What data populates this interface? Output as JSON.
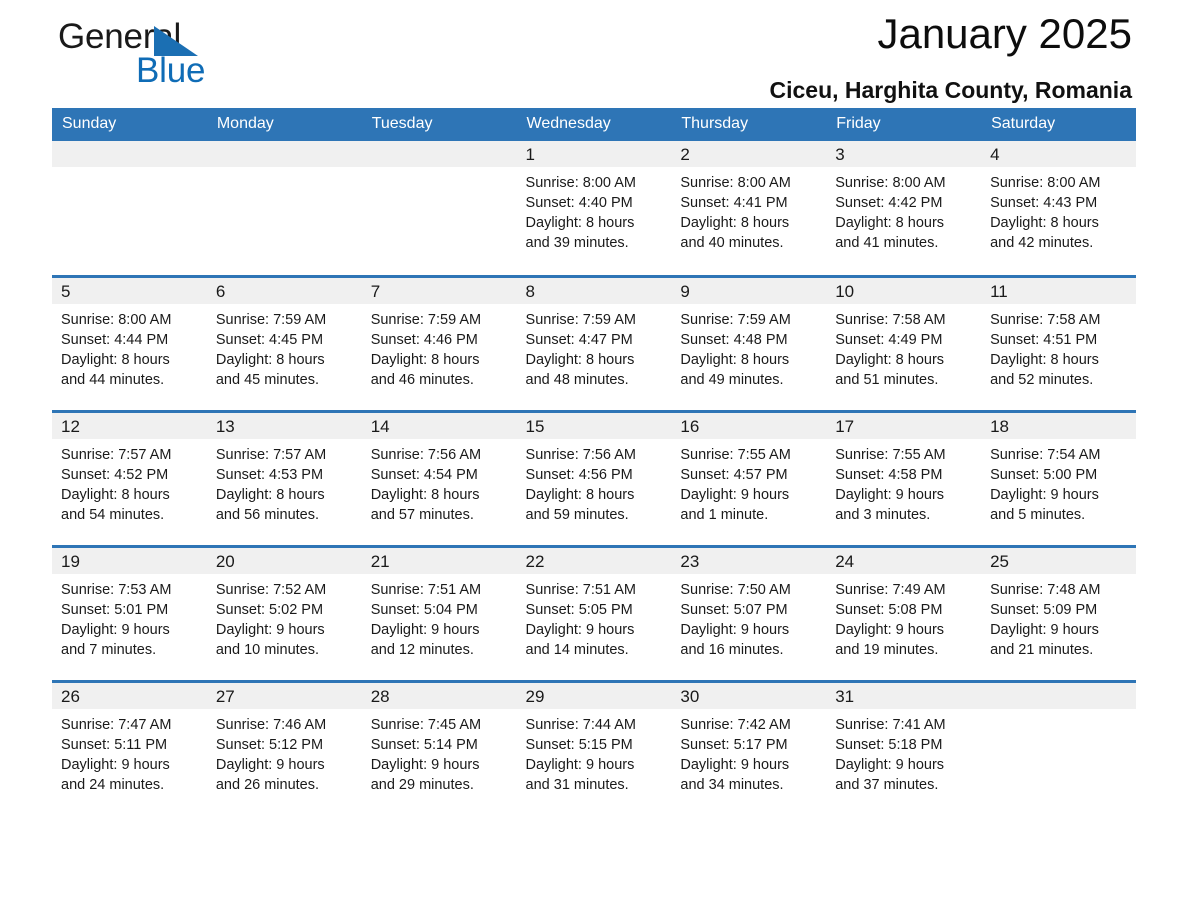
{
  "brand": {
    "name_part1": "General",
    "name_part2": "Blue",
    "triangle_icon": "triangle-icon",
    "accent_color": "#0f6cb6"
  },
  "header": {
    "title": "January 2025",
    "subtitle": "Ciceu, Harghita County, Romania"
  },
  "colors": {
    "header_blue": "#2e75b6",
    "daynum_band": "#f0f0f0",
    "text": "#1a1a1a"
  },
  "weekday_headers": [
    "Sunday",
    "Monday",
    "Tuesday",
    "Wednesday",
    "Thursday",
    "Friday",
    "Saturday"
  ],
  "weeks": [
    [
      {
        "day": "",
        "sunrise": "",
        "sunset": "",
        "daylight_line1": "",
        "daylight_line2": "",
        "empty": true
      },
      {
        "day": "",
        "sunrise": "",
        "sunset": "",
        "daylight_line1": "",
        "daylight_line2": "",
        "empty": true
      },
      {
        "day": "",
        "sunrise": "",
        "sunset": "",
        "daylight_line1": "",
        "daylight_line2": "",
        "empty": true
      },
      {
        "day": "1",
        "sunrise": "Sunrise: 8:00 AM",
        "sunset": "Sunset: 4:40 PM",
        "daylight_line1": "Daylight: 8 hours",
        "daylight_line2": "and 39 minutes."
      },
      {
        "day": "2",
        "sunrise": "Sunrise: 8:00 AM",
        "sunset": "Sunset: 4:41 PM",
        "daylight_line1": "Daylight: 8 hours",
        "daylight_line2": "and 40 minutes."
      },
      {
        "day": "3",
        "sunrise": "Sunrise: 8:00 AM",
        "sunset": "Sunset: 4:42 PM",
        "daylight_line1": "Daylight: 8 hours",
        "daylight_line2": "and 41 minutes."
      },
      {
        "day": "4",
        "sunrise": "Sunrise: 8:00 AM",
        "sunset": "Sunset: 4:43 PM",
        "daylight_line1": "Daylight: 8 hours",
        "daylight_line2": "and 42 minutes."
      }
    ],
    [
      {
        "day": "5",
        "sunrise": "Sunrise: 8:00 AM",
        "sunset": "Sunset: 4:44 PM",
        "daylight_line1": "Daylight: 8 hours",
        "daylight_line2": "and 44 minutes."
      },
      {
        "day": "6",
        "sunrise": "Sunrise: 7:59 AM",
        "sunset": "Sunset: 4:45 PM",
        "daylight_line1": "Daylight: 8 hours",
        "daylight_line2": "and 45 minutes."
      },
      {
        "day": "7",
        "sunrise": "Sunrise: 7:59 AM",
        "sunset": "Sunset: 4:46 PM",
        "daylight_line1": "Daylight: 8 hours",
        "daylight_line2": "and 46 minutes."
      },
      {
        "day": "8",
        "sunrise": "Sunrise: 7:59 AM",
        "sunset": "Sunset: 4:47 PM",
        "daylight_line1": "Daylight: 8 hours",
        "daylight_line2": "and 48 minutes."
      },
      {
        "day": "9",
        "sunrise": "Sunrise: 7:59 AM",
        "sunset": "Sunset: 4:48 PM",
        "daylight_line1": "Daylight: 8 hours",
        "daylight_line2": "and 49 minutes."
      },
      {
        "day": "10",
        "sunrise": "Sunrise: 7:58 AM",
        "sunset": "Sunset: 4:49 PM",
        "daylight_line1": "Daylight: 8 hours",
        "daylight_line2": "and 51 minutes."
      },
      {
        "day": "11",
        "sunrise": "Sunrise: 7:58 AM",
        "sunset": "Sunset: 4:51 PM",
        "daylight_line1": "Daylight: 8 hours",
        "daylight_line2": "and 52 minutes."
      }
    ],
    [
      {
        "day": "12",
        "sunrise": "Sunrise: 7:57 AM",
        "sunset": "Sunset: 4:52 PM",
        "daylight_line1": "Daylight: 8 hours",
        "daylight_line2": "and 54 minutes."
      },
      {
        "day": "13",
        "sunrise": "Sunrise: 7:57 AM",
        "sunset": "Sunset: 4:53 PM",
        "daylight_line1": "Daylight: 8 hours",
        "daylight_line2": "and 56 minutes."
      },
      {
        "day": "14",
        "sunrise": "Sunrise: 7:56 AM",
        "sunset": "Sunset: 4:54 PM",
        "daylight_line1": "Daylight: 8 hours",
        "daylight_line2": "and 57 minutes."
      },
      {
        "day": "15",
        "sunrise": "Sunrise: 7:56 AM",
        "sunset": "Sunset: 4:56 PM",
        "daylight_line1": "Daylight: 8 hours",
        "daylight_line2": "and 59 minutes."
      },
      {
        "day": "16",
        "sunrise": "Sunrise: 7:55 AM",
        "sunset": "Sunset: 4:57 PM",
        "daylight_line1": "Daylight: 9 hours",
        "daylight_line2": "and 1 minute."
      },
      {
        "day": "17",
        "sunrise": "Sunrise: 7:55 AM",
        "sunset": "Sunset: 4:58 PM",
        "daylight_line1": "Daylight: 9 hours",
        "daylight_line2": "and 3 minutes."
      },
      {
        "day": "18",
        "sunrise": "Sunrise: 7:54 AM",
        "sunset": "Sunset: 5:00 PM",
        "daylight_line1": "Daylight: 9 hours",
        "daylight_line2": "and 5 minutes."
      }
    ],
    [
      {
        "day": "19",
        "sunrise": "Sunrise: 7:53 AM",
        "sunset": "Sunset: 5:01 PM",
        "daylight_line1": "Daylight: 9 hours",
        "daylight_line2": "and 7 minutes."
      },
      {
        "day": "20",
        "sunrise": "Sunrise: 7:52 AM",
        "sunset": "Sunset: 5:02 PM",
        "daylight_line1": "Daylight: 9 hours",
        "daylight_line2": "and 10 minutes."
      },
      {
        "day": "21",
        "sunrise": "Sunrise: 7:51 AM",
        "sunset": "Sunset: 5:04 PM",
        "daylight_line1": "Daylight: 9 hours",
        "daylight_line2": "and 12 minutes."
      },
      {
        "day": "22",
        "sunrise": "Sunrise: 7:51 AM",
        "sunset": "Sunset: 5:05 PM",
        "daylight_line1": "Daylight: 9 hours",
        "daylight_line2": "and 14 minutes."
      },
      {
        "day": "23",
        "sunrise": "Sunrise: 7:50 AM",
        "sunset": "Sunset: 5:07 PM",
        "daylight_line1": "Daylight: 9 hours",
        "daylight_line2": "and 16 minutes."
      },
      {
        "day": "24",
        "sunrise": "Sunrise: 7:49 AM",
        "sunset": "Sunset: 5:08 PM",
        "daylight_line1": "Daylight: 9 hours",
        "daylight_line2": "and 19 minutes."
      },
      {
        "day": "25",
        "sunrise": "Sunrise: 7:48 AM",
        "sunset": "Sunset: 5:09 PM",
        "daylight_line1": "Daylight: 9 hours",
        "daylight_line2": "and 21 minutes."
      }
    ],
    [
      {
        "day": "26",
        "sunrise": "Sunrise: 7:47 AM",
        "sunset": "Sunset: 5:11 PM",
        "daylight_line1": "Daylight: 9 hours",
        "daylight_line2": "and 24 minutes."
      },
      {
        "day": "27",
        "sunrise": "Sunrise: 7:46 AM",
        "sunset": "Sunset: 5:12 PM",
        "daylight_line1": "Daylight: 9 hours",
        "daylight_line2": "and 26 minutes."
      },
      {
        "day": "28",
        "sunrise": "Sunrise: 7:45 AM",
        "sunset": "Sunset: 5:14 PM",
        "daylight_line1": "Daylight: 9 hours",
        "daylight_line2": "and 29 minutes."
      },
      {
        "day": "29",
        "sunrise": "Sunrise: 7:44 AM",
        "sunset": "Sunset: 5:15 PM",
        "daylight_line1": "Daylight: 9 hours",
        "daylight_line2": "and 31 minutes."
      },
      {
        "day": "30",
        "sunrise": "Sunrise: 7:42 AM",
        "sunset": "Sunset: 5:17 PM",
        "daylight_line1": "Daylight: 9 hours",
        "daylight_line2": "and 34 minutes."
      },
      {
        "day": "31",
        "sunrise": "Sunrise: 7:41 AM",
        "sunset": "Sunset: 5:18 PM",
        "daylight_line1": "Daylight: 9 hours",
        "daylight_line2": "and 37 minutes."
      },
      {
        "day": "",
        "sunrise": "",
        "sunset": "",
        "daylight_line1": "",
        "daylight_line2": "",
        "empty": true
      }
    ]
  ]
}
